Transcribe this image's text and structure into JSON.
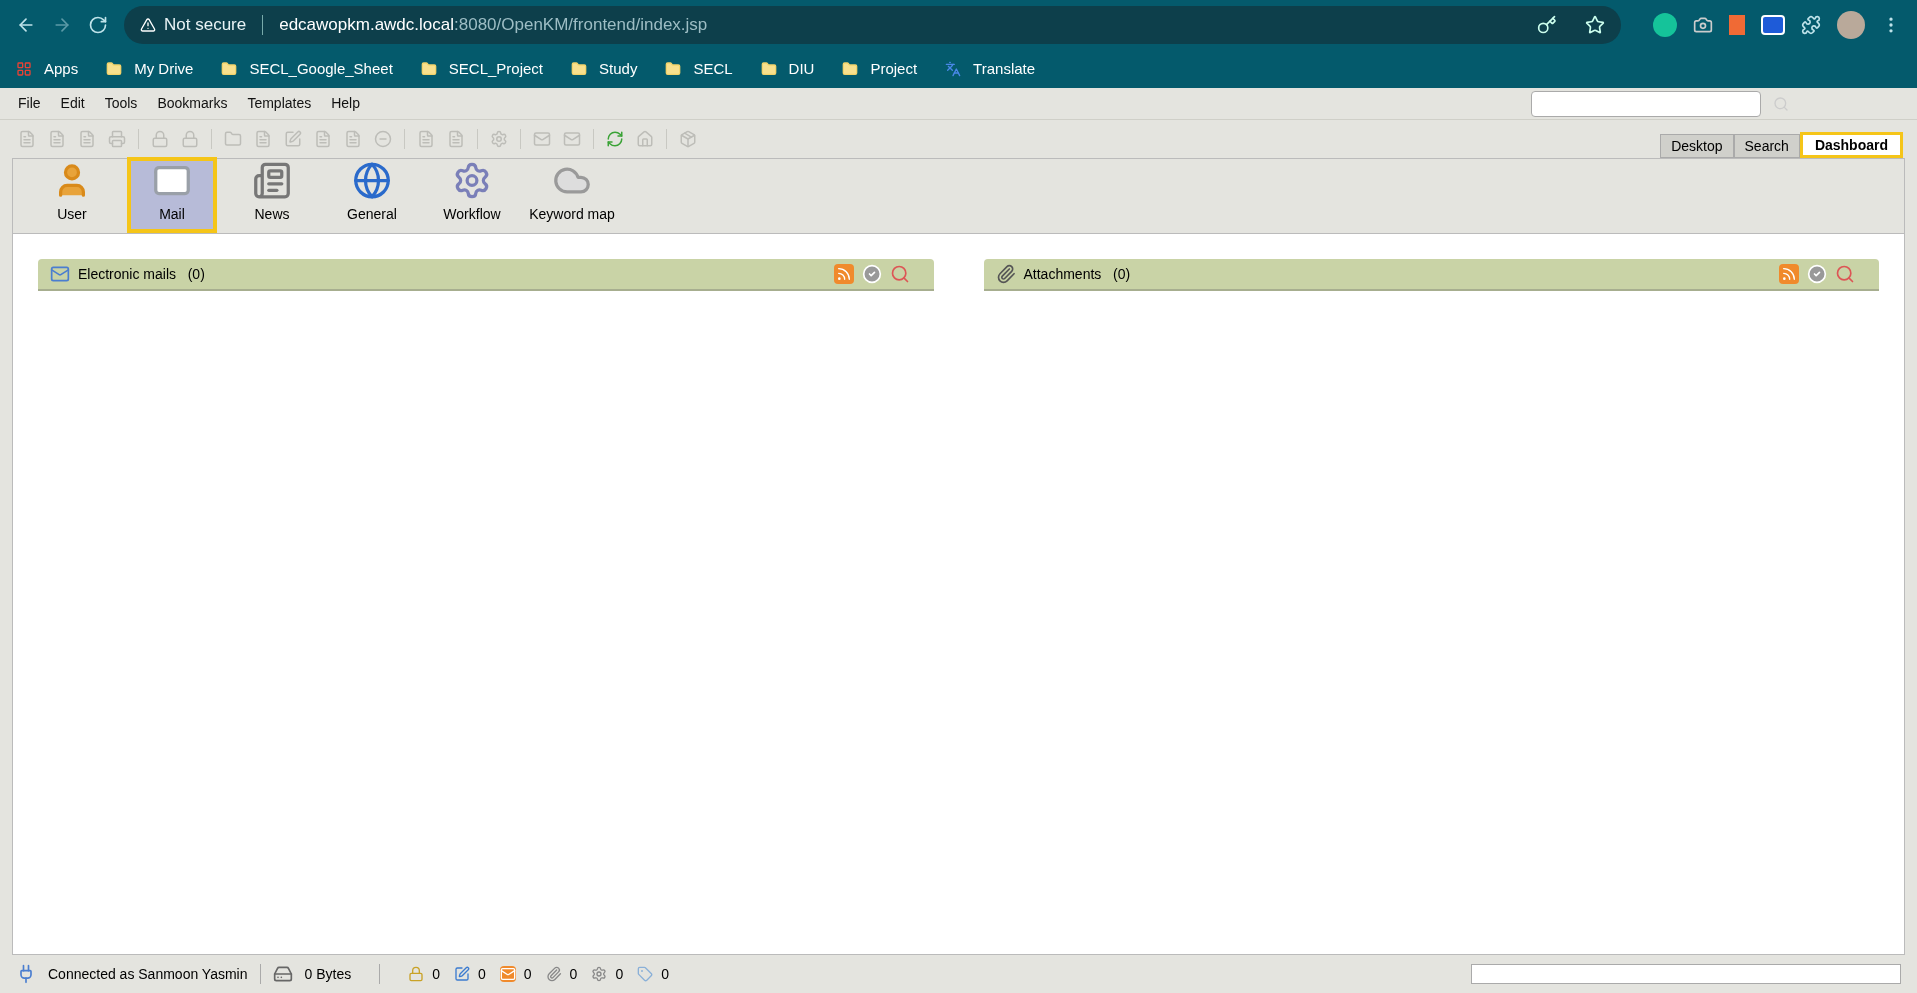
{
  "browser": {
    "security": "Not secure",
    "url_host": "edcawopkm.awdc.local",
    "url_rest": ":8080/OpenKM/frontend/index.jsp",
    "bookmarks": [
      {
        "kind": "apps",
        "label": "Apps"
      },
      {
        "kind": "folder",
        "label": "My Drive"
      },
      {
        "kind": "folder",
        "label": "SECL_Google_Sheet"
      },
      {
        "kind": "folder",
        "label": "SECL_Project"
      },
      {
        "kind": "folder",
        "label": "Study"
      },
      {
        "kind": "folder",
        "label": "SECL"
      },
      {
        "kind": "folder",
        "label": "DIU"
      },
      {
        "kind": "folder",
        "label": "Project"
      },
      {
        "kind": "translate",
        "label": "Translate"
      }
    ]
  },
  "menu": [
    "File",
    "Edit",
    "Tools",
    "Bookmarks",
    "Templates",
    "Help"
  ],
  "tabs": [
    {
      "label": "Desktop",
      "selected": false
    },
    {
      "label": "Search",
      "selected": false
    },
    {
      "label": "Dashboard",
      "selected": true
    }
  ],
  "tools": [
    {
      "kind": "user",
      "label": "User",
      "selected": false
    },
    {
      "kind": "mail",
      "label": "Mail",
      "selected": true
    },
    {
      "kind": "news",
      "label": "News",
      "selected": false
    },
    {
      "kind": "general",
      "label": "General",
      "selected": false
    },
    {
      "kind": "workflow",
      "label": "Workflow",
      "selected": false
    },
    {
      "kind": "keyword",
      "label": "Keyword map",
      "selected": false
    }
  ],
  "panels": [
    {
      "kind": "mail",
      "title": "Electronic mails",
      "count": "(0)"
    },
    {
      "kind": "attachment",
      "title": "Attachments",
      "count": "(0)"
    }
  ],
  "status_bar": {
    "user": "Connected as Sanmoon Yasmin",
    "size": "0 Bytes",
    "counters": [
      {
        "kind": "locked",
        "value": "0"
      },
      {
        "kind": "checkout",
        "value": "0"
      },
      {
        "kind": "mail",
        "value": "0"
      },
      {
        "kind": "attach",
        "value": "0"
      },
      {
        "kind": "workflow",
        "value": "0"
      },
      {
        "kind": "tag",
        "value": "0"
      }
    ]
  }
}
